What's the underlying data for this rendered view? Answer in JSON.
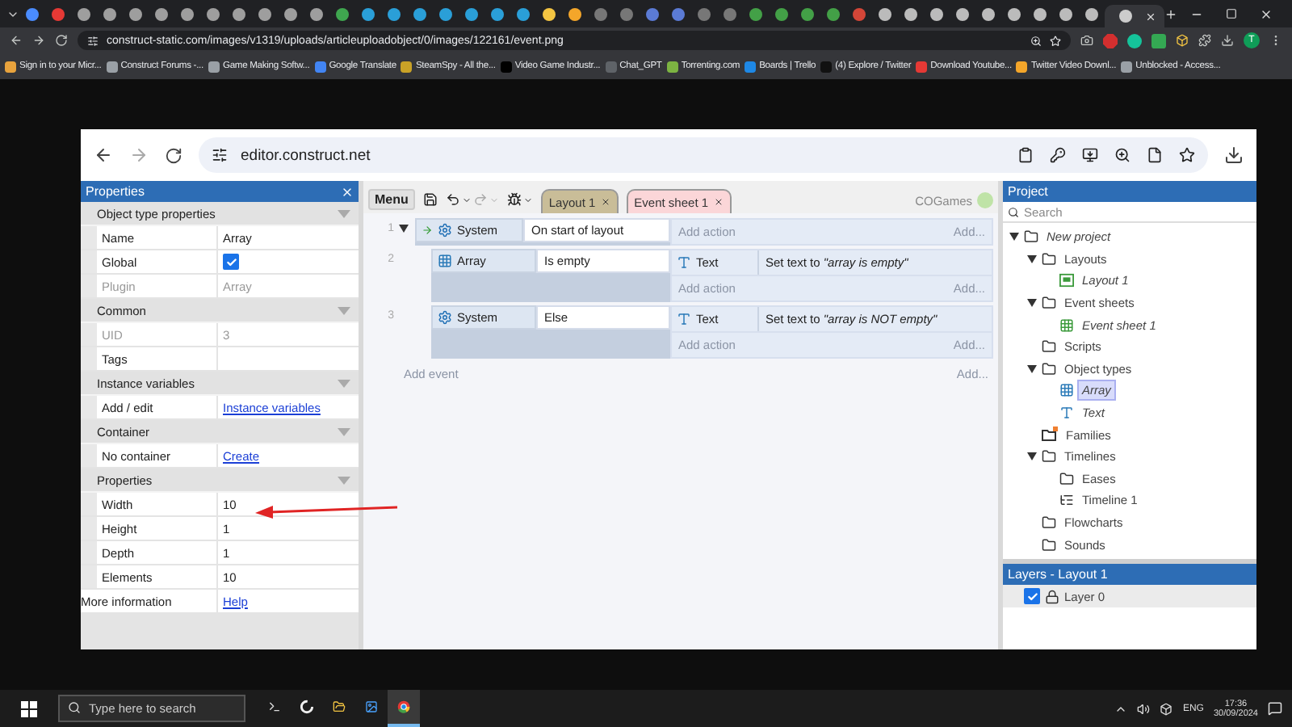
{
  "browser": {
    "address": "construct-static.com/images/v1319/uploads/articleuploadobject/0/images/122161/event.png",
    "profile_initial": "T",
    "bookmarks": [
      {
        "label": "Sign in to your Micr...",
        "color": "#e8a33d"
      },
      {
        "label": "Construct Forums -...",
        "color": "#9aa0a6"
      },
      {
        "label": "Game Making Softw...",
        "color": "#9aa0a6"
      },
      {
        "label": "Google Translate",
        "color": "#4285f4"
      },
      {
        "label": "SteamSpy - All the...",
        "color": "#c9a227"
      },
      {
        "label": "Video Game Industr...",
        "color": "#000000"
      },
      {
        "label": "Chat_GPT",
        "color": "#5f6368"
      },
      {
        "label": "Torrenting.com",
        "color": "#7cb342"
      },
      {
        "label": "Boards | Trello",
        "color": "#1e88e5"
      },
      {
        "label": "(4) Explore / Twitter",
        "color": "#111111"
      },
      {
        "label": "Download Youtube...",
        "color": "#e53935"
      },
      {
        "label": "Twitter Video Downl...",
        "color": "#f4a62a"
      },
      {
        "label": "Unblocked - Access...",
        "color": "#9aa0a6"
      }
    ]
  },
  "inner_browser": {
    "address": "editor.construct.net"
  },
  "toolbar": {
    "menu": "Menu",
    "tabs": [
      {
        "label": "Layout 1",
        "selected": false
      },
      {
        "label": "Event sheet 1",
        "selected": true
      }
    ],
    "user": "COGames"
  },
  "properties": {
    "title": "Properties",
    "sections": [
      {
        "title": "Object type properties",
        "expanded": true,
        "rows": [
          {
            "name": "Name",
            "kind": "text",
            "value": "Array",
            "disabled": false
          },
          {
            "name": "Global",
            "kind": "checkbox",
            "checked": true,
            "disabled": false
          },
          {
            "name": "Plugin",
            "kind": "text",
            "value": "Array",
            "disabled": true
          }
        ]
      },
      {
        "title": "Common",
        "expanded": true,
        "rows": [
          {
            "name": "UID",
            "kind": "text",
            "value": "3",
            "disabled": true
          },
          {
            "name": "Tags",
            "kind": "text",
            "disabled": false
          }
        ]
      },
      {
        "title": "Instance variables",
        "expanded": true,
        "rows": [
          {
            "name": "Add / edit",
            "kind": "link",
            "value": "Instance variables",
            "disabled": false
          }
        ]
      },
      {
        "title": "Container",
        "expanded": true,
        "rows": [
          {
            "name": "No container",
            "kind": "link",
            "value": "Create",
            "disabled": false
          }
        ]
      },
      {
        "title": "Properties",
        "expanded": true,
        "rows": [
          {
            "name": "Width",
            "kind": "text",
            "value": "10",
            "disabled": false
          },
          {
            "name": "Height",
            "kind": "text",
            "value": "1",
            "disabled": false
          },
          {
            "name": "Depth",
            "kind": "text",
            "value": "1",
            "disabled": false
          },
          {
            "name": "Elements",
            "kind": "text",
            "value": "10",
            "disabled": false
          }
        ]
      }
    ],
    "footer": {
      "name": "More information",
      "link": "Help"
    }
  },
  "events": [
    {
      "number": "1",
      "expanded": true,
      "conditions": [
        {
          "object": "System",
          "kind": "system",
          "text": "On start of layout",
          "trigger": true
        }
      ],
      "add_action": "Add action",
      "add_more": "Add...",
      "children": [
        {
          "number": "2",
          "conditions": [
            {
              "object": "Array",
              "kind": "array",
              "text": "Is empty",
              "trigger": false
            }
          ],
          "actions": [
            {
              "object": "Text",
              "kind": "text",
              "text": "Set text to *\"array is empty\"*"
            }
          ],
          "add_action": "Add action",
          "add_more": "Add..."
        },
        {
          "number": "3",
          "conditions": [
            {
              "object": "System",
              "kind": "system",
              "text": "Else",
              "trigger": false
            }
          ],
          "actions": [
            {
              "object": "Text",
              "kind": "text",
              "text": "Set text to *\"array is NOT empty\"*"
            }
          ],
          "add_action": "Add action",
          "add_more": "Add..."
        }
      ]
    }
  ],
  "add_event": "Add event",
  "add_event_more": "Add...",
  "project": {
    "title": "Project",
    "search_placeholder": "Search",
    "tree": [
      {
        "label": "New project",
        "kind": "project",
        "expanded": true,
        "selected": false,
        "children": [
          {
            "label": "Layouts",
            "kind": "folder",
            "expanded": true,
            "selected": false,
            "children": [
              {
                "label": "Layout 1",
                "kind": "layout",
                "selected": false
              }
            ]
          },
          {
            "label": "Event sheets",
            "kind": "folder",
            "expanded": true,
            "selected": false,
            "children": [
              {
                "label": "Event sheet 1",
                "kind": "eventsheet",
                "selected": false
              }
            ]
          },
          {
            "label": "Scripts",
            "kind": "folder",
            "selected": false
          },
          {
            "label": "Object types",
            "kind": "folder",
            "expanded": true,
            "selected": false,
            "children": [
              {
                "label": "Array",
                "kind": "array",
                "selected": true
              },
              {
                "label": "Text",
                "kind": "text",
                "selected": false
              }
            ]
          },
          {
            "label": "Families",
            "kind": "families",
            "selected": false
          },
          {
            "label": "Timelines",
            "kind": "folder",
            "expanded": true,
            "selected": false,
            "children": [
              {
                "label": "Eases",
                "kind": "folder",
                "selected": false
              },
              {
                "label": "Timeline 1",
                "kind": "timeline",
                "selected": false
              }
            ]
          },
          {
            "label": "Flowcharts",
            "kind": "folder",
            "selected": false
          },
          {
            "label": "Sounds",
            "kind": "folder",
            "selected": false
          }
        ]
      }
    ]
  },
  "layers": {
    "title": "Layers - Layout 1",
    "items": [
      {
        "label": "Layer 0",
        "visible": true
      }
    ]
  },
  "taskbar": {
    "search_placeholder": "Type here to search",
    "apps": [
      {
        "kind": "terminal",
        "selected": false
      },
      {
        "kind": "construct",
        "selected": false
      },
      {
        "kind": "files",
        "selected": false
      },
      {
        "kind": "paint",
        "selected": false
      },
      {
        "kind": "chrome",
        "selected": true
      }
    ],
    "language": "ENG",
    "time": "17:36",
    "date": "30/09/2024"
  }
}
